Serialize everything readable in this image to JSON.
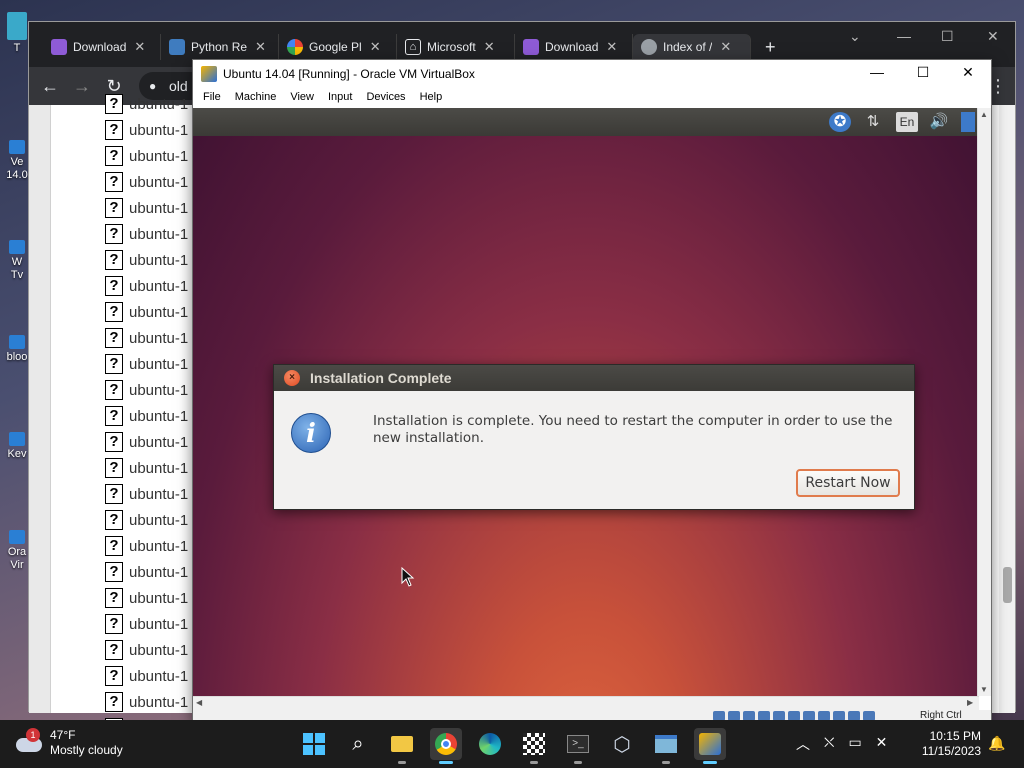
{
  "desktop": {
    "icons": [
      {
        "label": "T"
      },
      {
        "label": "Ve\n14.0"
      },
      {
        "label": "W\nTv"
      },
      {
        "label": "bloo"
      },
      {
        "label": "Kev"
      },
      {
        "label": "Ora\nVir"
      }
    ]
  },
  "browser": {
    "tabs": [
      {
        "label": "Download",
        "icon": "visual-studio-icon",
        "color": "#8e5bd6"
      },
      {
        "label": "Python Re",
        "icon": "python-icon",
        "color": "#3f7cbf"
      },
      {
        "label": "Google Pl",
        "icon": "google-photos-icon",
        "color": "#f4b400"
      },
      {
        "label": "Microsoft",
        "icon": "library-icon",
        "color": "#e8eaed"
      },
      {
        "label": "Download",
        "icon": "visual-studio-icon",
        "color": "#8e5bd6"
      },
      {
        "label": "Index of /",
        "icon": "globe-icon",
        "color": "#9aa0a6"
      }
    ],
    "new_tab": "+",
    "address_partial": "old",
    "file_rows": [
      "ubuntu-1",
      "ubuntu-1",
      "ubuntu-1",
      "ubuntu-1",
      "ubuntu-1",
      "ubuntu-1",
      "ubuntu-1",
      "ubuntu-1",
      "ubuntu-1",
      "ubuntu-1",
      "ubuntu-1",
      "ubuntu-1",
      "ubuntu-1",
      "ubuntu-1",
      "ubuntu-1",
      "ubuntu-1",
      "ubuntu-1",
      "ubuntu-1",
      "ubuntu-1",
      "ubuntu-1",
      "ubuntu-1",
      "ubuntu-1",
      "ubuntu-1",
      "ubuntu-1",
      "ubuntu-1"
    ],
    "file_icon_glyph": "?"
  },
  "vbox": {
    "title": "Ubuntu 14.04 [Running] - Oracle VM VirtualBox",
    "menu": [
      "File",
      "Machine",
      "View",
      "Input",
      "Devices",
      "Help"
    ],
    "status_host_key": "Right Ctrl"
  },
  "guest": {
    "panel": {
      "language": "En"
    },
    "dialog": {
      "title": "Installation Complete",
      "message": "Installation is complete. You need to restart the computer in order to use the new installation.",
      "button": "Restart Now",
      "info_glyph": "i",
      "close_glyph": "×"
    }
  },
  "taskbar": {
    "weather_temp": "47°F",
    "weather_desc": "Mostly cloudy",
    "weather_badge": "1",
    "time": "10:15 PM",
    "date": "11/15/2023"
  },
  "colors": {
    "accent_button_border": "#e07b4c",
    "ubuntu_panel": "#3c3b37",
    "taskbar_bg": "#1c1c1c"
  }
}
